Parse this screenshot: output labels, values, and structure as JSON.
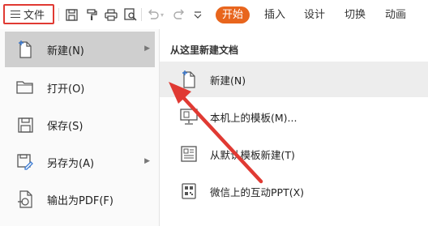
{
  "toolbar": {
    "file_label": "文件",
    "icons": [
      "save-icon",
      "format-painter-icon",
      "print-icon",
      "print-preview-icon",
      "undo-icon",
      "redo-icon",
      "more-icon"
    ],
    "tabs": [
      {
        "label": "开始",
        "active": true
      },
      {
        "label": "插入",
        "active": false
      },
      {
        "label": "设计",
        "active": false
      },
      {
        "label": "切换",
        "active": false
      },
      {
        "label": "动画",
        "active": false
      }
    ]
  },
  "file_menu": {
    "items": [
      {
        "label": "新建(N)",
        "icon": "new-doc-icon",
        "has_submenu": true,
        "selected": true
      },
      {
        "label": "打开(O)",
        "icon": "folder-icon",
        "has_submenu": false
      },
      {
        "label": "保存(S)",
        "icon": "save-icon",
        "has_submenu": false
      },
      {
        "label": "另存为(A)",
        "icon": "save-as-icon",
        "has_submenu": true
      },
      {
        "label": "输出为PDF(F)",
        "icon": "pdf-export-icon",
        "has_submenu": false
      }
    ]
  },
  "submenu": {
    "title": "从这里新建文档",
    "items": [
      {
        "label": "新建(N)",
        "icon": "new-doc-icon"
      },
      {
        "label": "本机上的模板(M)...",
        "icon": "local-template-icon"
      },
      {
        "label": "从默认模板新建(T)",
        "icon": "default-template-icon"
      },
      {
        "label": "微信上的互动PPT(X)",
        "icon": "qr-code-icon"
      }
    ]
  },
  "colors": {
    "accent": "#e8651d",
    "highlight_border": "#e03a33",
    "annotation_arrow": "#e03a33",
    "menu_selected": "#cfcfcf"
  }
}
